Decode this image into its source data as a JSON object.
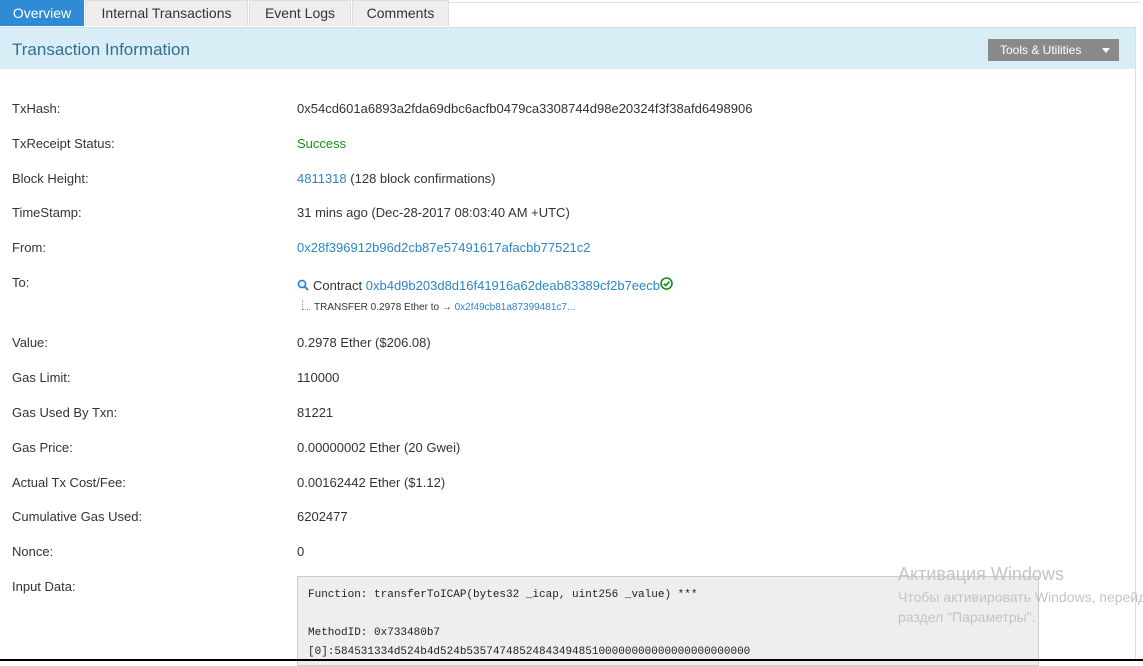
{
  "tabs": [
    {
      "label": "Overview",
      "active": true
    },
    {
      "label": "Internal Transactions",
      "active": false
    },
    {
      "label": "Event Logs",
      "active": false
    },
    {
      "label": "Comments",
      "active": false
    }
  ],
  "header": {
    "title": "Transaction Information",
    "tools_label": "Tools & Utilities"
  },
  "fields": {
    "txhash": {
      "label": "TxHash:",
      "value": "0x54cd601a6893a2fda69dbc6acfb0479ca3308744d98e20324f3f38afd6498906"
    },
    "status": {
      "label": "TxReceipt Status:",
      "value": "Success"
    },
    "block": {
      "label": "Block Height:",
      "value": "4811318",
      "note": "(128 block confirmations)"
    },
    "timestamp": {
      "label": "TimeStamp:",
      "value": "31 mins ago (Dec-28-2017 08:03:40 AM +UTC)"
    },
    "from": {
      "label": "From:",
      "value": "0x28f396912b96d2cb87e57491617afacbb77521c2"
    },
    "to": {
      "label": "To:",
      "prefix": "Contract",
      "value": "0xb4d9b203d8d16f41916a62deab83389cf2b7eecb",
      "transfer_text": "TRANSFER  0.2978 Ether  to",
      "transfer_arrow": "→",
      "transfer_target": "0x2f49cb81a87399481c7..."
    },
    "value": {
      "label": "Value:",
      "value": "0.2978 Ether ($206.08)"
    },
    "gas_limit": {
      "label": "Gas Limit:",
      "value": "110000"
    },
    "gas_used": {
      "label": "Gas Used By Txn:",
      "value": "81221"
    },
    "gas_price": {
      "label": "Gas Price:",
      "value": "0.00000002 Ether (20 Gwei)"
    },
    "actual_cost": {
      "label": "Actual Tx Cost/Fee:",
      "value": "0.00162442 Ether ($1.12)"
    },
    "cumulative_gas": {
      "label": "Cumulative Gas Used:",
      "value": "6202477"
    },
    "nonce": {
      "label": "Nonce:",
      "value": "0"
    },
    "input_data": {
      "label": "Input Data:",
      "function_line": "Function: transferToICAP(bytes32 _icap, uint256 _value) ***",
      "method_line": "MethodID: 0x733480b7",
      "param0_line": "[0]:584531334d524b4d524b5357474852484349485100000000000000000000000"
    }
  },
  "watermark": {
    "line1": "Активация Windows",
    "line2": "Чтобы активировать Windows, перейдите в",
    "line3": "раздел \"Параметры\"."
  },
  "colors": {
    "tab_active": "#2e8bd4",
    "header_bg": "#d9edf7",
    "header_title": "#31708f",
    "link": "#2b86c9",
    "success": "#1a8f1a",
    "tools_btn": "#8a8a8a"
  },
  "icons": {
    "contract_magnifier": "search-icon",
    "verified_check": "check-circle-icon",
    "tools_dropdown": "caret-down-icon"
  }
}
